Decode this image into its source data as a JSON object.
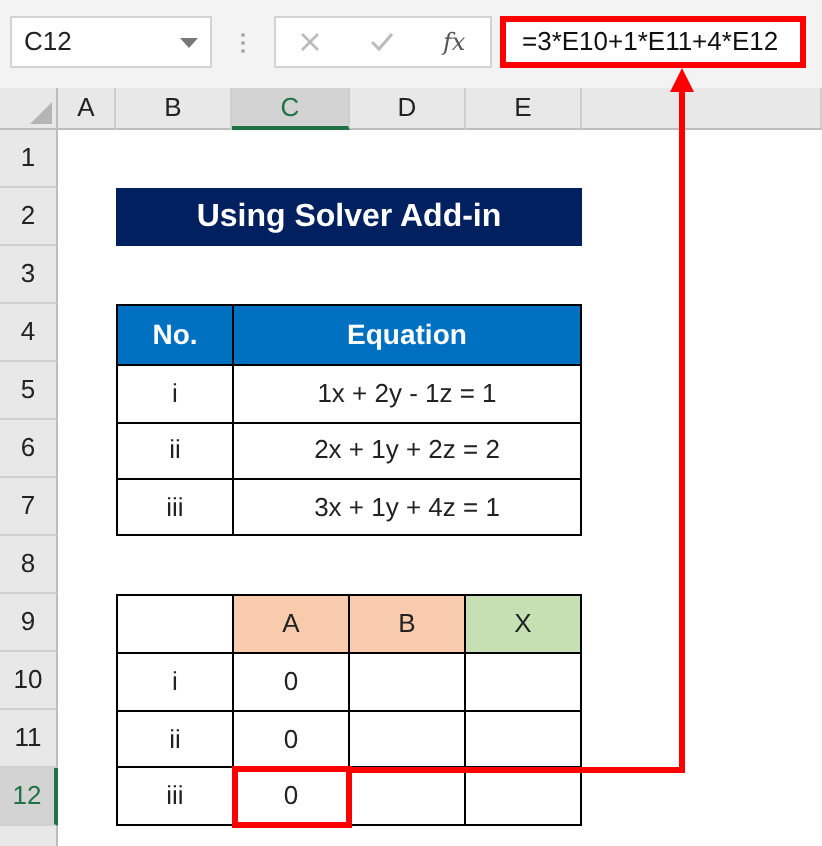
{
  "formula_bar": {
    "name_box": "C12",
    "function_label": "fx",
    "formula": "=3*E10+1*E11+4*E12"
  },
  "columns": [
    {
      "label": "A",
      "selected": false
    },
    {
      "label": "B",
      "selected": false
    },
    {
      "label": "C",
      "selected": true
    },
    {
      "label": "D",
      "selected": false
    },
    {
      "label": "E",
      "selected": false
    }
  ],
  "rows": [
    {
      "label": "1",
      "selected": false
    },
    {
      "label": "2",
      "selected": false
    },
    {
      "label": "3",
      "selected": false
    },
    {
      "label": "4",
      "selected": false
    },
    {
      "label": "5",
      "selected": false
    },
    {
      "label": "6",
      "selected": false
    },
    {
      "label": "7",
      "selected": false
    },
    {
      "label": "8",
      "selected": false
    },
    {
      "label": "9",
      "selected": false
    },
    {
      "label": "10",
      "selected": false
    },
    {
      "label": "11",
      "selected": false
    },
    {
      "label": "12",
      "selected": true
    }
  ],
  "title": "Using Solver Add-in",
  "equations_table": {
    "columns": [
      "No.",
      "Equation"
    ],
    "rows": [
      [
        "i",
        "1x + 2y - 1z = 1"
      ],
      [
        "ii",
        "2x + 1y + 2z = 2"
      ],
      [
        "iii",
        "3x + 1y + 4z = 1"
      ]
    ]
  },
  "solver_table": {
    "columns": [
      {
        "color": "#ffffff"
      },
      {
        "label": "A",
        "color": "#f8cbad"
      },
      {
        "label": "B",
        "color": "#f8cbad"
      },
      {
        "label": "X",
        "color": "#c6e0b4"
      }
    ],
    "rows": [
      {
        "cells": [
          "i",
          "0",
          "",
          ""
        ],
        "highlighted": false
      },
      {
        "cells": [
          "ii",
          "0",
          "",
          ""
        ],
        "highlighted": false
      },
      {
        "cells": [
          "iii",
          "0",
          "",
          ""
        ],
        "highlighted": true
      }
    ]
  }
}
